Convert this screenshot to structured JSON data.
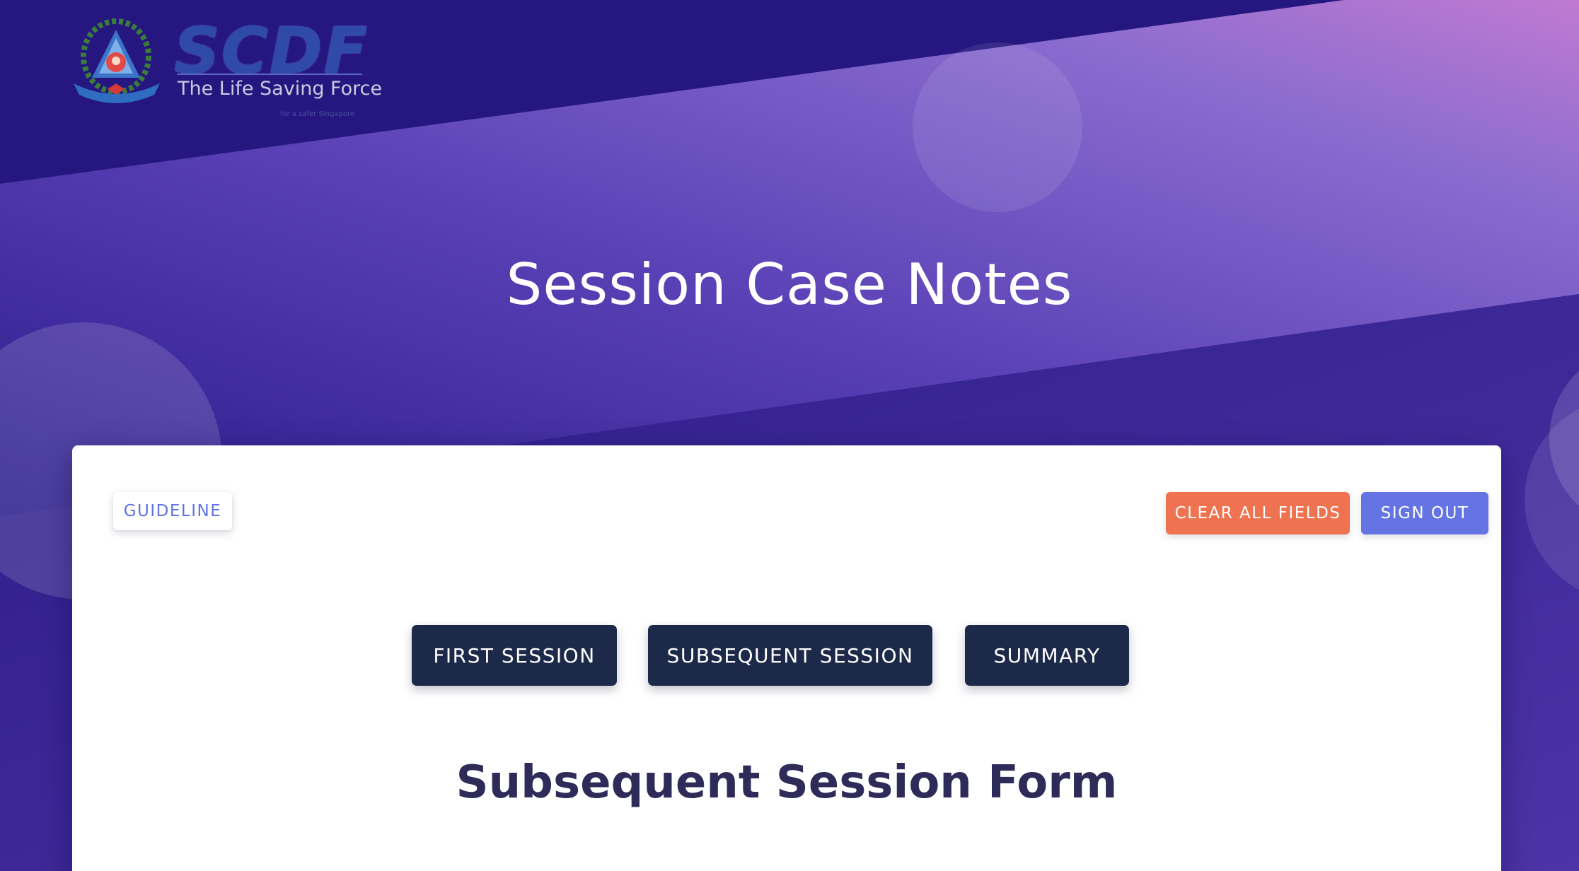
{
  "header": {
    "logo": {
      "brand": "SCDF",
      "tagline": "The Life Saving Force",
      "caption": "for a safer Singapore"
    },
    "title": "Session Case Notes"
  },
  "card": {
    "guideline_label": "GUIDELINE",
    "clear_label": "CLEAR ALL FIELDS",
    "signout_label": "SIGN OUT",
    "session_tabs": [
      {
        "label": "FIRST SESSION"
      },
      {
        "label": "SUBSEQUENT SESSION"
      },
      {
        "label": "SUMMARY"
      }
    ],
    "form_title": "Subsequent Session Form"
  },
  "colors": {
    "background": "#25177f",
    "accent_clear": "#ef7350",
    "accent_signout": "#6574e3",
    "guideline_text": "#5e72e4",
    "session_button": "#1d2949",
    "form_title": "#2f2b59"
  },
  "icons": [
    "scdf-emblem-icon"
  ]
}
